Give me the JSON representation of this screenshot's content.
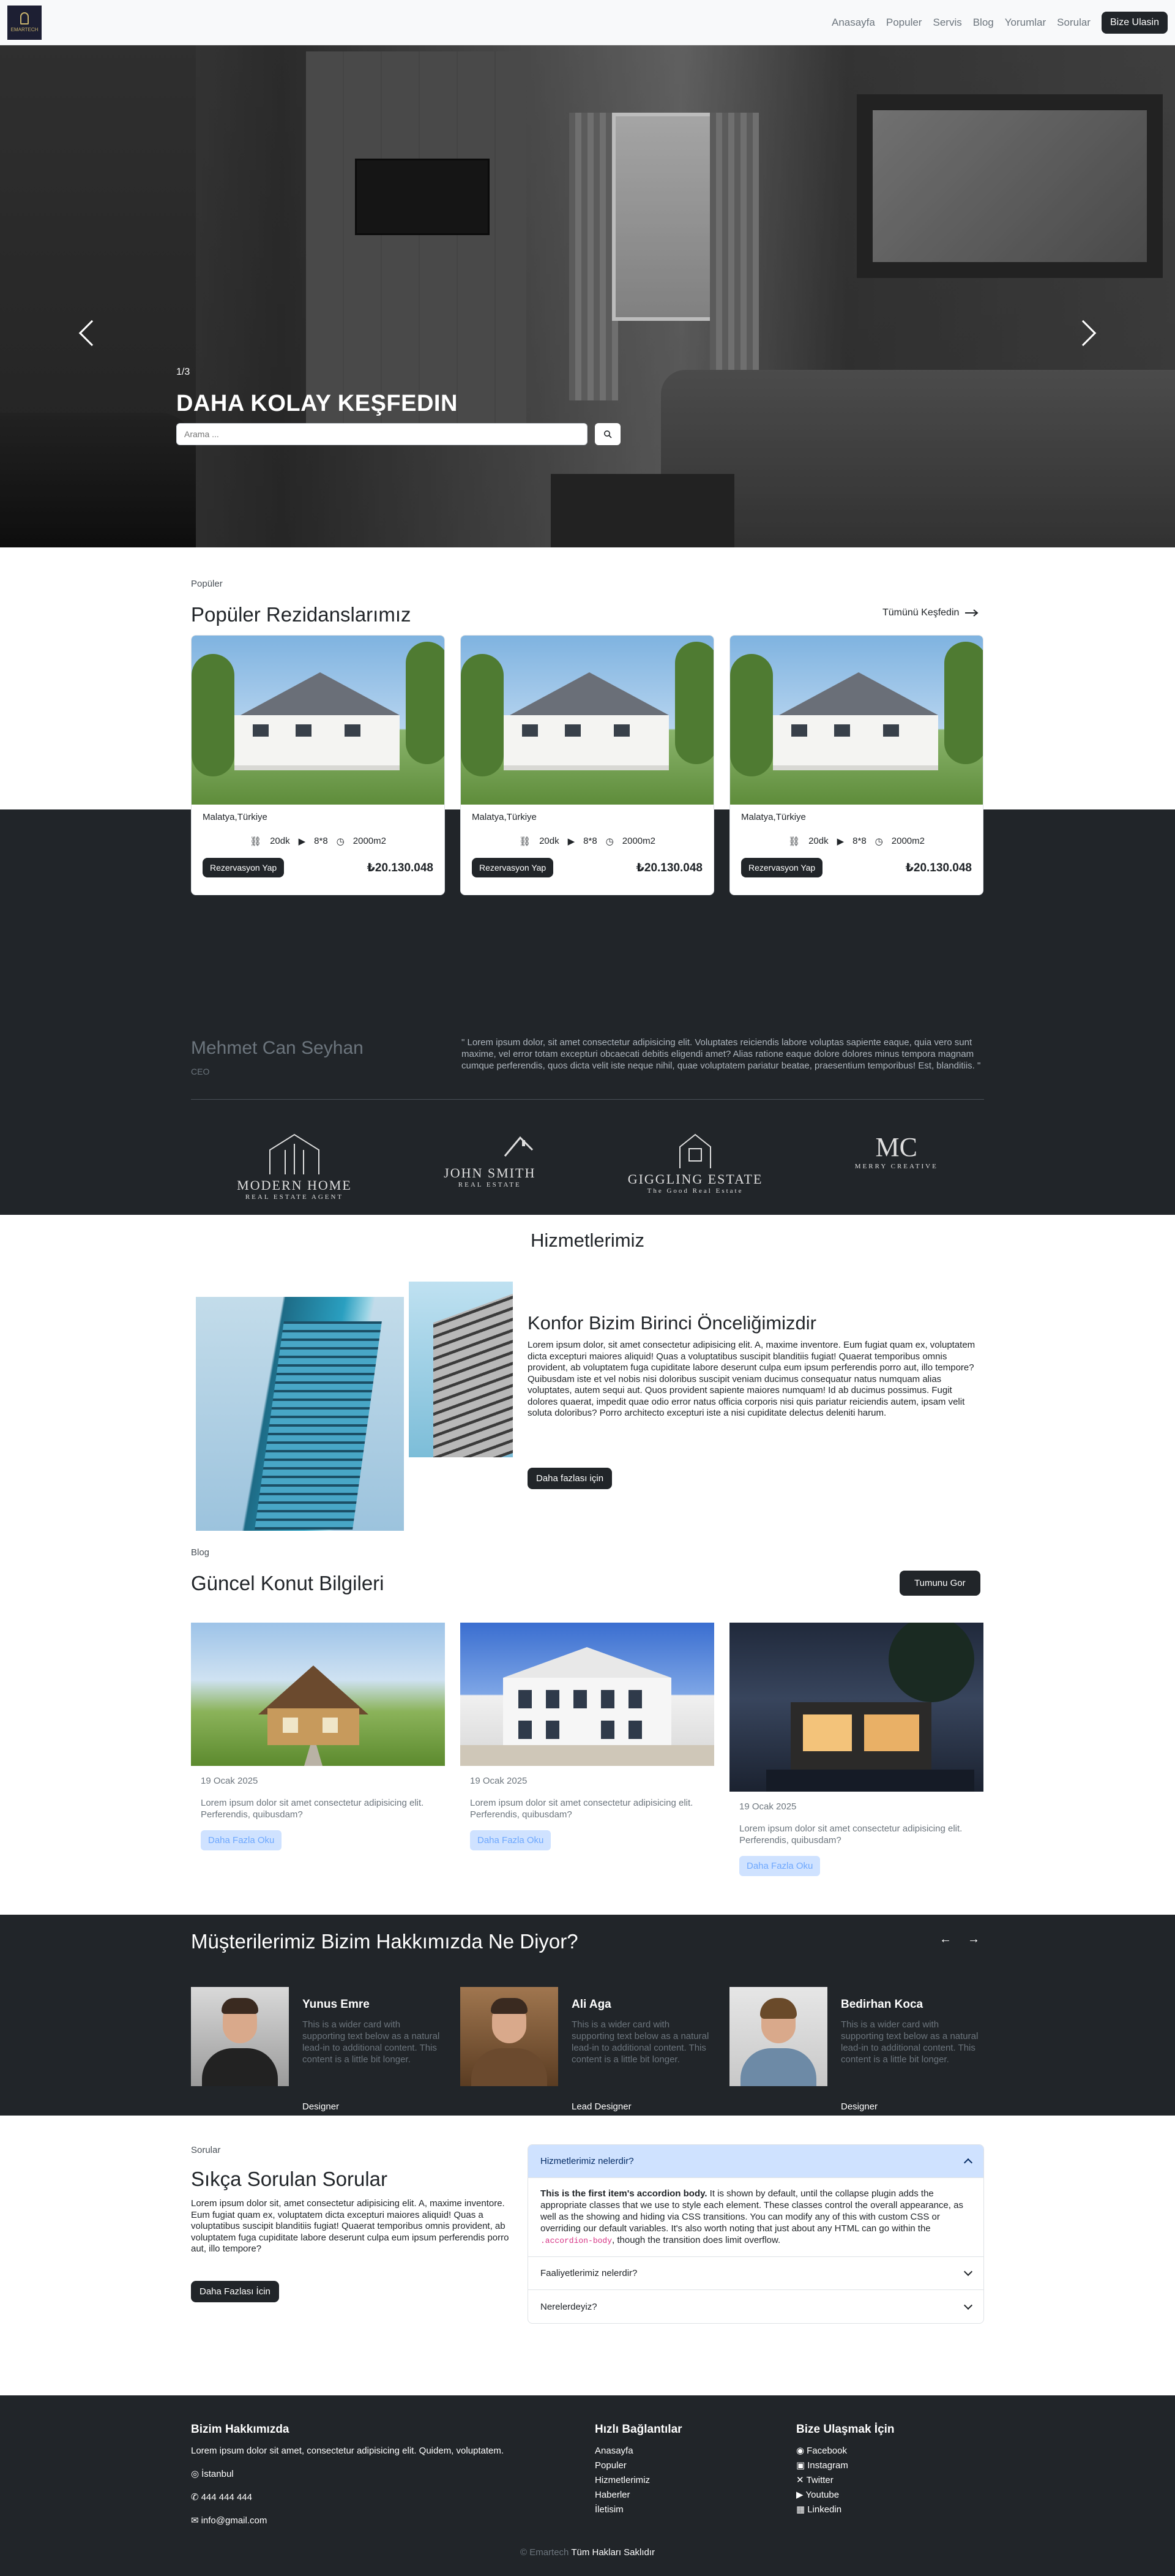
{
  "nav": {
    "logo_text": "EMARTECH",
    "links": [
      "Anasayfa",
      "Populer",
      "Servis",
      "Blog",
      "Yorumlar",
      "Sorular"
    ],
    "cta": "Bize Ulasin"
  },
  "hero": {
    "counter": "1/3",
    "title": "DAHA KOLAY KEŞFEDIN",
    "search_placeholder": "Arama ...",
    "search_icon": "search-icon"
  },
  "popular": {
    "tag": "Popüler",
    "title": "Popüler Rezidanslarımız",
    "see_all": "Tümünü Keşfedin",
    "cards": [
      {
        "location": "Malatya,Türkiye",
        "rooms": "20dk",
        "beds": "8*8",
        "area": "2000m2",
        "button": "Rezervasyon Yap",
        "price": "₺20.130.048"
      },
      {
        "location": "Malatya,Türkiye",
        "rooms": "20dk",
        "beds": "8*8",
        "area": "2000m2",
        "button": "Rezervasyon Yap",
        "price": "₺20.130.048"
      },
      {
        "location": "Malatya,Türkiye",
        "rooms": "20dk",
        "beds": "8*8",
        "area": "2000m2",
        "button": "Rezervasyon Yap",
        "price": "₺20.130.048"
      }
    ]
  },
  "ceo": {
    "name": "Mehmet Can Seyhan",
    "role": "CEO",
    "quote": "\" Lorem ipsum dolor, sit amet consectetur adipisicing elit. Voluptates reiciendis labore voluptas sapiente eaque, quia vero sunt maxime, vel error totam excepturi obcaecati debitis eligendi amet? Alias ratione eaque dolore dolores minus tempora magnam cumque perferendis, quos dicta velit iste neque nihil, quae voluptatem pariatur beatae, praesentium temporibus! Est, blanditiis. \""
  },
  "partners": [
    {
      "line1": "MODERN HOME",
      "line2": "REAL ESTATE AGENT"
    },
    {
      "line1": "JOHN SMITH",
      "line2": "REAL ESTATE"
    },
    {
      "line1": "GIGGLING ESTATE",
      "line2": "The Good Real Estate"
    },
    {
      "line1": "MC",
      "line2": "MERRY CREATIVE"
    }
  ],
  "services": {
    "title": "Hizmetlerimiz",
    "heading": "Konfor Bizim Birinci Önceliğimizdir",
    "text": "Lorem ipsum dolor, sit amet consectetur adipisicing elit. A, maxime inventore. Eum fugiat quam ex, voluptatem dicta excepturi maiores aliquid! Quas a voluptatibus suscipit blanditiis fugiat! Quaerat temporibus omnis provident, ab voluptatem fuga cupiditate labore deserunt culpa eum ipsum perferendis porro aut, illo tempore? Quibusdam iste et vel nobis nisi doloribus suscipit veniam ducimus consequatur natus numquam alias voluptates, autem sequi aut. Quos provident sapiente maiores numquam! Id ab ducimus possimus. Fugit dolores quaerat, impedit quae odio error natus officia corporis nisi quis pariatur reiciendis autem, ipsam velit soluta doloribus? Porro architecto excepturi iste a nisi cupiditate delectus deleniti harum.",
    "button": "Daha fazlası için"
  },
  "blog": {
    "tag": "Blog",
    "title": "Güncel Konut Bilgileri",
    "button": "Tumunu Gor",
    "posts": [
      {
        "date": "19 Ocak 2025",
        "excerpt": "Lorem ipsum dolor sit amet consectetur adipisicing elit. Perferendis, quibusdam?",
        "button": "Daha Fazla Oku"
      },
      {
        "date": "19 Ocak 2025",
        "excerpt": "Lorem ipsum dolor sit amet consectetur adipisicing elit. Perferendis, quibusdam?",
        "button": "Daha Fazla Oku"
      },
      {
        "date": "19 Ocak 2025",
        "excerpt": "Lorem ipsum dolor sit amet consectetur adipisicing elit. Perferendis, quibusdam?",
        "button": "Daha Fazla Oku"
      }
    ]
  },
  "customers": {
    "title": "Müşterilerimiz Bizim Hakkımızda Ne Diyor?",
    "prev": "←",
    "next": "→",
    "items": [
      {
        "name": "Yunus Emre",
        "text": "This is a wider card with supporting text below as a natural lead-in to additional content. This content is a little bit longer.",
        "role": "Designer"
      },
      {
        "name": "Ali Aga",
        "text": "This is a wider card with supporting text below as a natural lead-in to additional content. This content is a little bit longer.",
        "role": "Lead Designer"
      },
      {
        "name": "Bedirhan Koca",
        "text": "This is a wider card with supporting text below as a natural lead-in to additional content. This content is a little bit longer.",
        "role": "Designer"
      }
    ]
  },
  "faq": {
    "tag": "Sorular",
    "title": "Sıkça Sorulan Sorular",
    "text": "Lorem ipsum dolor sit, amet consectetur adipisicing elit. A, maxime inventore. Eum fugiat quam ex, voluptatem dicta excepturi maiores aliquid! Quas a voluptatibus suscipit blanditiis fugiat! Quaerat temporibus omnis provident, ab voluptatem fuga cupiditate labore deserunt culpa eum ipsum perferendis porro aut, illo tempore?",
    "button": "Daha Fazlası İcin",
    "items": [
      {
        "q": "Hizmetlerimiz nelerdir?"
      },
      {
        "q": "Faaliyetlerimiz nelerdir?"
      },
      {
        "q": "Nerelerdeyiz?"
      }
    ],
    "open_body_bold": "This is the first item's accordion body.",
    "open_body_a": " It is shown by default, until the collapse plugin adds the appropriate classes that we use to style each element. These classes control the overall appearance, as well as the showing and hiding via CSS transitions. You can modify any of this with custom CSS or overriding our default variables. It's also worth noting that just about any HTML can go within the ",
    "open_body_code": ".accordion-body",
    "open_body_b": ", though the transition does limit overflow."
  },
  "footer": {
    "about_title": "Bizim Hakkımızda",
    "about_text": "Lorem ipsum dolor sit amet, consectetur adipisicing elit. Quidem, voluptatem.",
    "city": "İstanbul",
    "phone": "444 444 444",
    "email": "info@gmail.com",
    "links_title": "Hızlı Bağlantılar",
    "links": [
      "Anasayfa",
      "Populer",
      "Hizmetlerimiz",
      "Haberler",
      "İletisim"
    ],
    "contact_title": "Bize Ulaşmak İçin",
    "social": [
      "Facebook",
      "Instagram",
      "Twitter",
      "Youtube",
      "Linkedin"
    ],
    "copy_brand": "Emartech",
    "copy_text": "Tüm Hakları Saklıdır",
    "copy_symbol": "©"
  }
}
